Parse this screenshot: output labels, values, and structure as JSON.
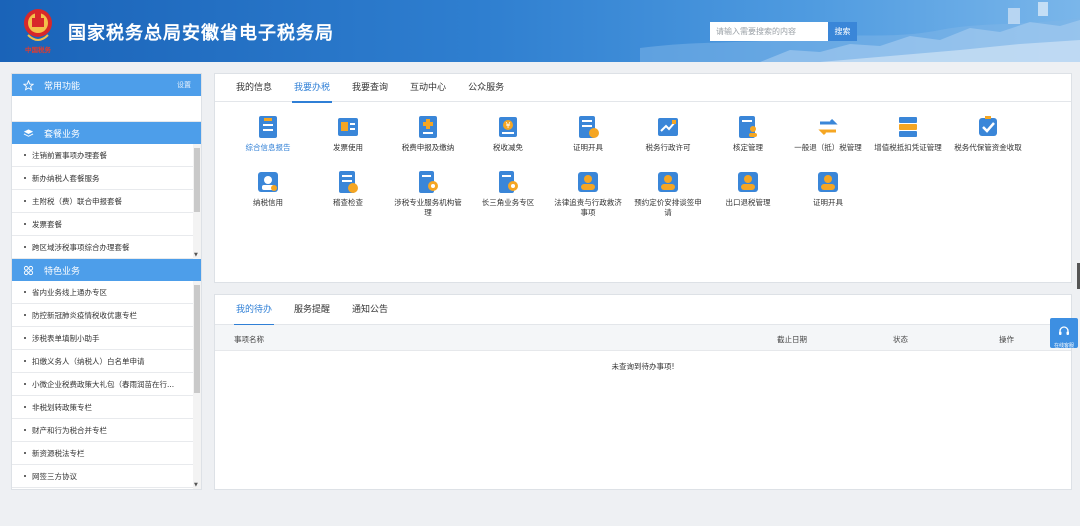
{
  "header": {
    "title": "国家税务总局安徽省电子税务局",
    "search_placeholder": "请输入需要搜索的内容",
    "search_button": "搜索",
    "emblem_text": "中国税务",
    "brand_color": "#2f7fd0"
  },
  "sidebar": {
    "common": {
      "label": "常用功能",
      "settings": "设置"
    },
    "package": {
      "label": "套餐业务",
      "items": [
        "注销前置事项办理套餐",
        "新办纳税人套餐服务",
        "主附税（费）联合申报套餐",
        "发票套餐",
        "跨区域涉税事项综合办理套餐"
      ]
    },
    "feature": {
      "label": "特色业务",
      "items": [
        "省内业务线上通办专区",
        "防控新冠肺炎疫情税收优惠专栏",
        "涉税表单填制小助手",
        "扣缴义务人（纳税人）白名单申请",
        "小微企业税费政策大礼包（春雨润苗在行...",
        "非税划转政策专栏",
        "财产和行为税合并专栏",
        "新资源税法专栏",
        "网签三方协议"
      ]
    }
  },
  "main_tabs": [
    "我的信息",
    "我要办税",
    "我要查询",
    "互动中心",
    "公众服务"
  ],
  "main_tabs_active": "我要办税",
  "services_row1": [
    "综合信息报告",
    "发票使用",
    "税费申报及缴纳",
    "税收减免",
    "证明开具",
    "税务行政许可",
    "核定管理",
    "一般退（抵）税管理",
    "增值税抵扣凭证管理",
    "税务代保管资金收取"
  ],
  "services_row2": [
    [
      "纳税信用"
    ],
    [
      "稽查检查"
    ],
    [
      "涉税专业服务机构管",
      "理"
    ],
    [
      "长三角业务专区"
    ],
    [
      "法律追责与行政救济",
      "事项"
    ],
    [
      "预约定价安排谈签申",
      "请"
    ],
    [
      "出口退税管理"
    ],
    [
      "证明开具"
    ]
  ],
  "todo_tabs": [
    "我的待办",
    "服务提醒",
    "通知公告"
  ],
  "todo_tabs_active": "我的待办",
  "table_headers": {
    "name": "事项名称",
    "deadline": "截止日期",
    "status": "状态",
    "action": "操作"
  },
  "empty_text": "未查询到待办事项!",
  "online_service": "在线客服",
  "icons": {
    "common": "star-icon",
    "package": "layers-icon",
    "feature": "grid-icon",
    "online": "headset-icon",
    "accent_blue": "#3a86d8",
    "accent_orange": "#f5a623"
  }
}
